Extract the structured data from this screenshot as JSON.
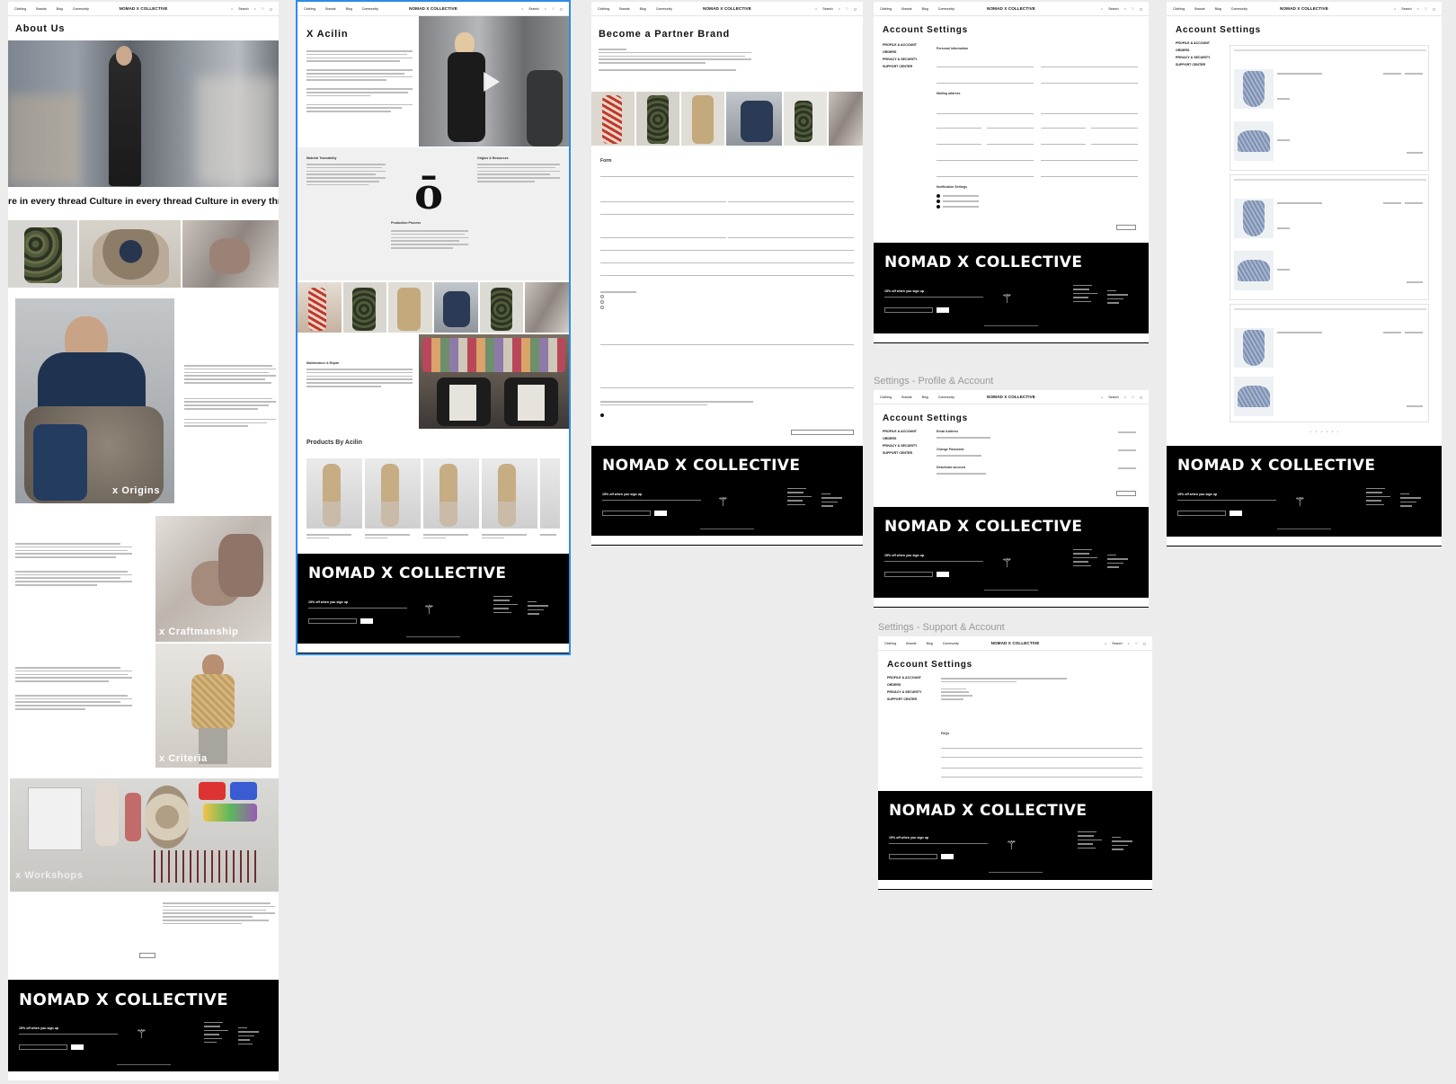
{
  "nav": {
    "links": [
      "Clothing",
      "Brands",
      "Blog",
      "Community"
    ],
    "brand": "NOMAD X COLLECTIVE",
    "search_label": "Search"
  },
  "about": {
    "title": "About Us",
    "marquee": "re in every thread Culture in every thread Culture in every thr",
    "origins": "x Origins",
    "craftmanship": "x Craftmanship",
    "criteria": "x Criteria",
    "workshops": "x Workshops"
  },
  "acilin": {
    "title": "X Acilin",
    "material_traceability": "Material Traceability",
    "origins_resources": "Origins & Resources",
    "production_process": "Production Process",
    "maintenance_repair": "Maintenance & Repair",
    "products_by": "Products By Acilin"
  },
  "partner": {
    "title": "Become a Partner Brand",
    "form": "Form"
  },
  "settings": {
    "title": "Account Settings",
    "menu": [
      "PROFILE & ACCOUNT",
      "ORDERS",
      "PRIVACY & SECURITY",
      "SUPPORT CENTER"
    ],
    "personal_information": "Personal Information",
    "mailing_address": "Mailing address",
    "notification_settings": "Notification Settings",
    "email_address": "Email Address",
    "change_password": "Change Password",
    "deactivate_account": "Deactivate account",
    "faqs": "FAQs"
  },
  "labels": {
    "profile_account": "Settings - Profile & Account",
    "support_account": "Settings - Support & Account"
  },
  "footer": {
    "brand": "NOMAD X COLLECTIVE",
    "signup": "15% off when you sign up"
  }
}
